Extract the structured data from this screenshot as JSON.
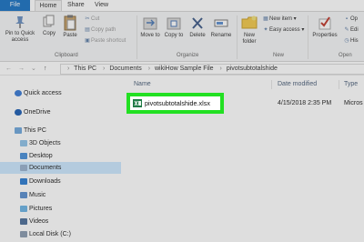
{
  "tabs": {
    "file": "File",
    "home": "Home",
    "share": "Share",
    "view": "View"
  },
  "ribbon": {
    "clipboard": {
      "pin_label": "Pin to Quick access",
      "copy_label": "Copy",
      "paste_label": "Paste",
      "cut_label": "Cut",
      "copy_path_label": "Copy path",
      "paste_shortcut_label": "Paste shortcut",
      "group_label": "Clipboard"
    },
    "organize": {
      "move_to_label": "Move to",
      "copy_to_label": "Copy to",
      "delete_label": "Delete",
      "rename_label": "Rename",
      "group_label": "Organize"
    },
    "new": {
      "new_folder_label": "New folder",
      "new_item_label": "New item",
      "easy_access_label": "Easy access",
      "group_label": "New"
    },
    "open": {
      "properties_label": "Properties",
      "open_label": "Op",
      "edit_label": "Edi",
      "history_label": "His",
      "group_label": "Open"
    }
  },
  "address": {
    "crumbs": [
      "This PC",
      "Documents",
      "wikiHow Sample File",
      "pivotsubtotalshide"
    ]
  },
  "nav": {
    "quick_access": "Quick access",
    "onedrive": "OneDrive",
    "this_pc": "This PC",
    "objects3d": "3D Objects",
    "desktop": "Desktop",
    "documents": "Documents",
    "downloads": "Downloads",
    "music": "Music",
    "pictures": "Pictures",
    "videos": "Videos",
    "local_disk": "Local Disk (C:)"
  },
  "columns": {
    "name": "Name",
    "date_modified": "Date modified",
    "type": "Type"
  },
  "files": [
    {
      "name": "pivotsubtotalshide.xlsx",
      "date": "4/15/2018 2:35 PM",
      "type": "Micros"
    }
  ],
  "colors": {
    "accent": "#1a73c4",
    "highlight": "#22e022",
    "selected": "#cce8ff"
  }
}
